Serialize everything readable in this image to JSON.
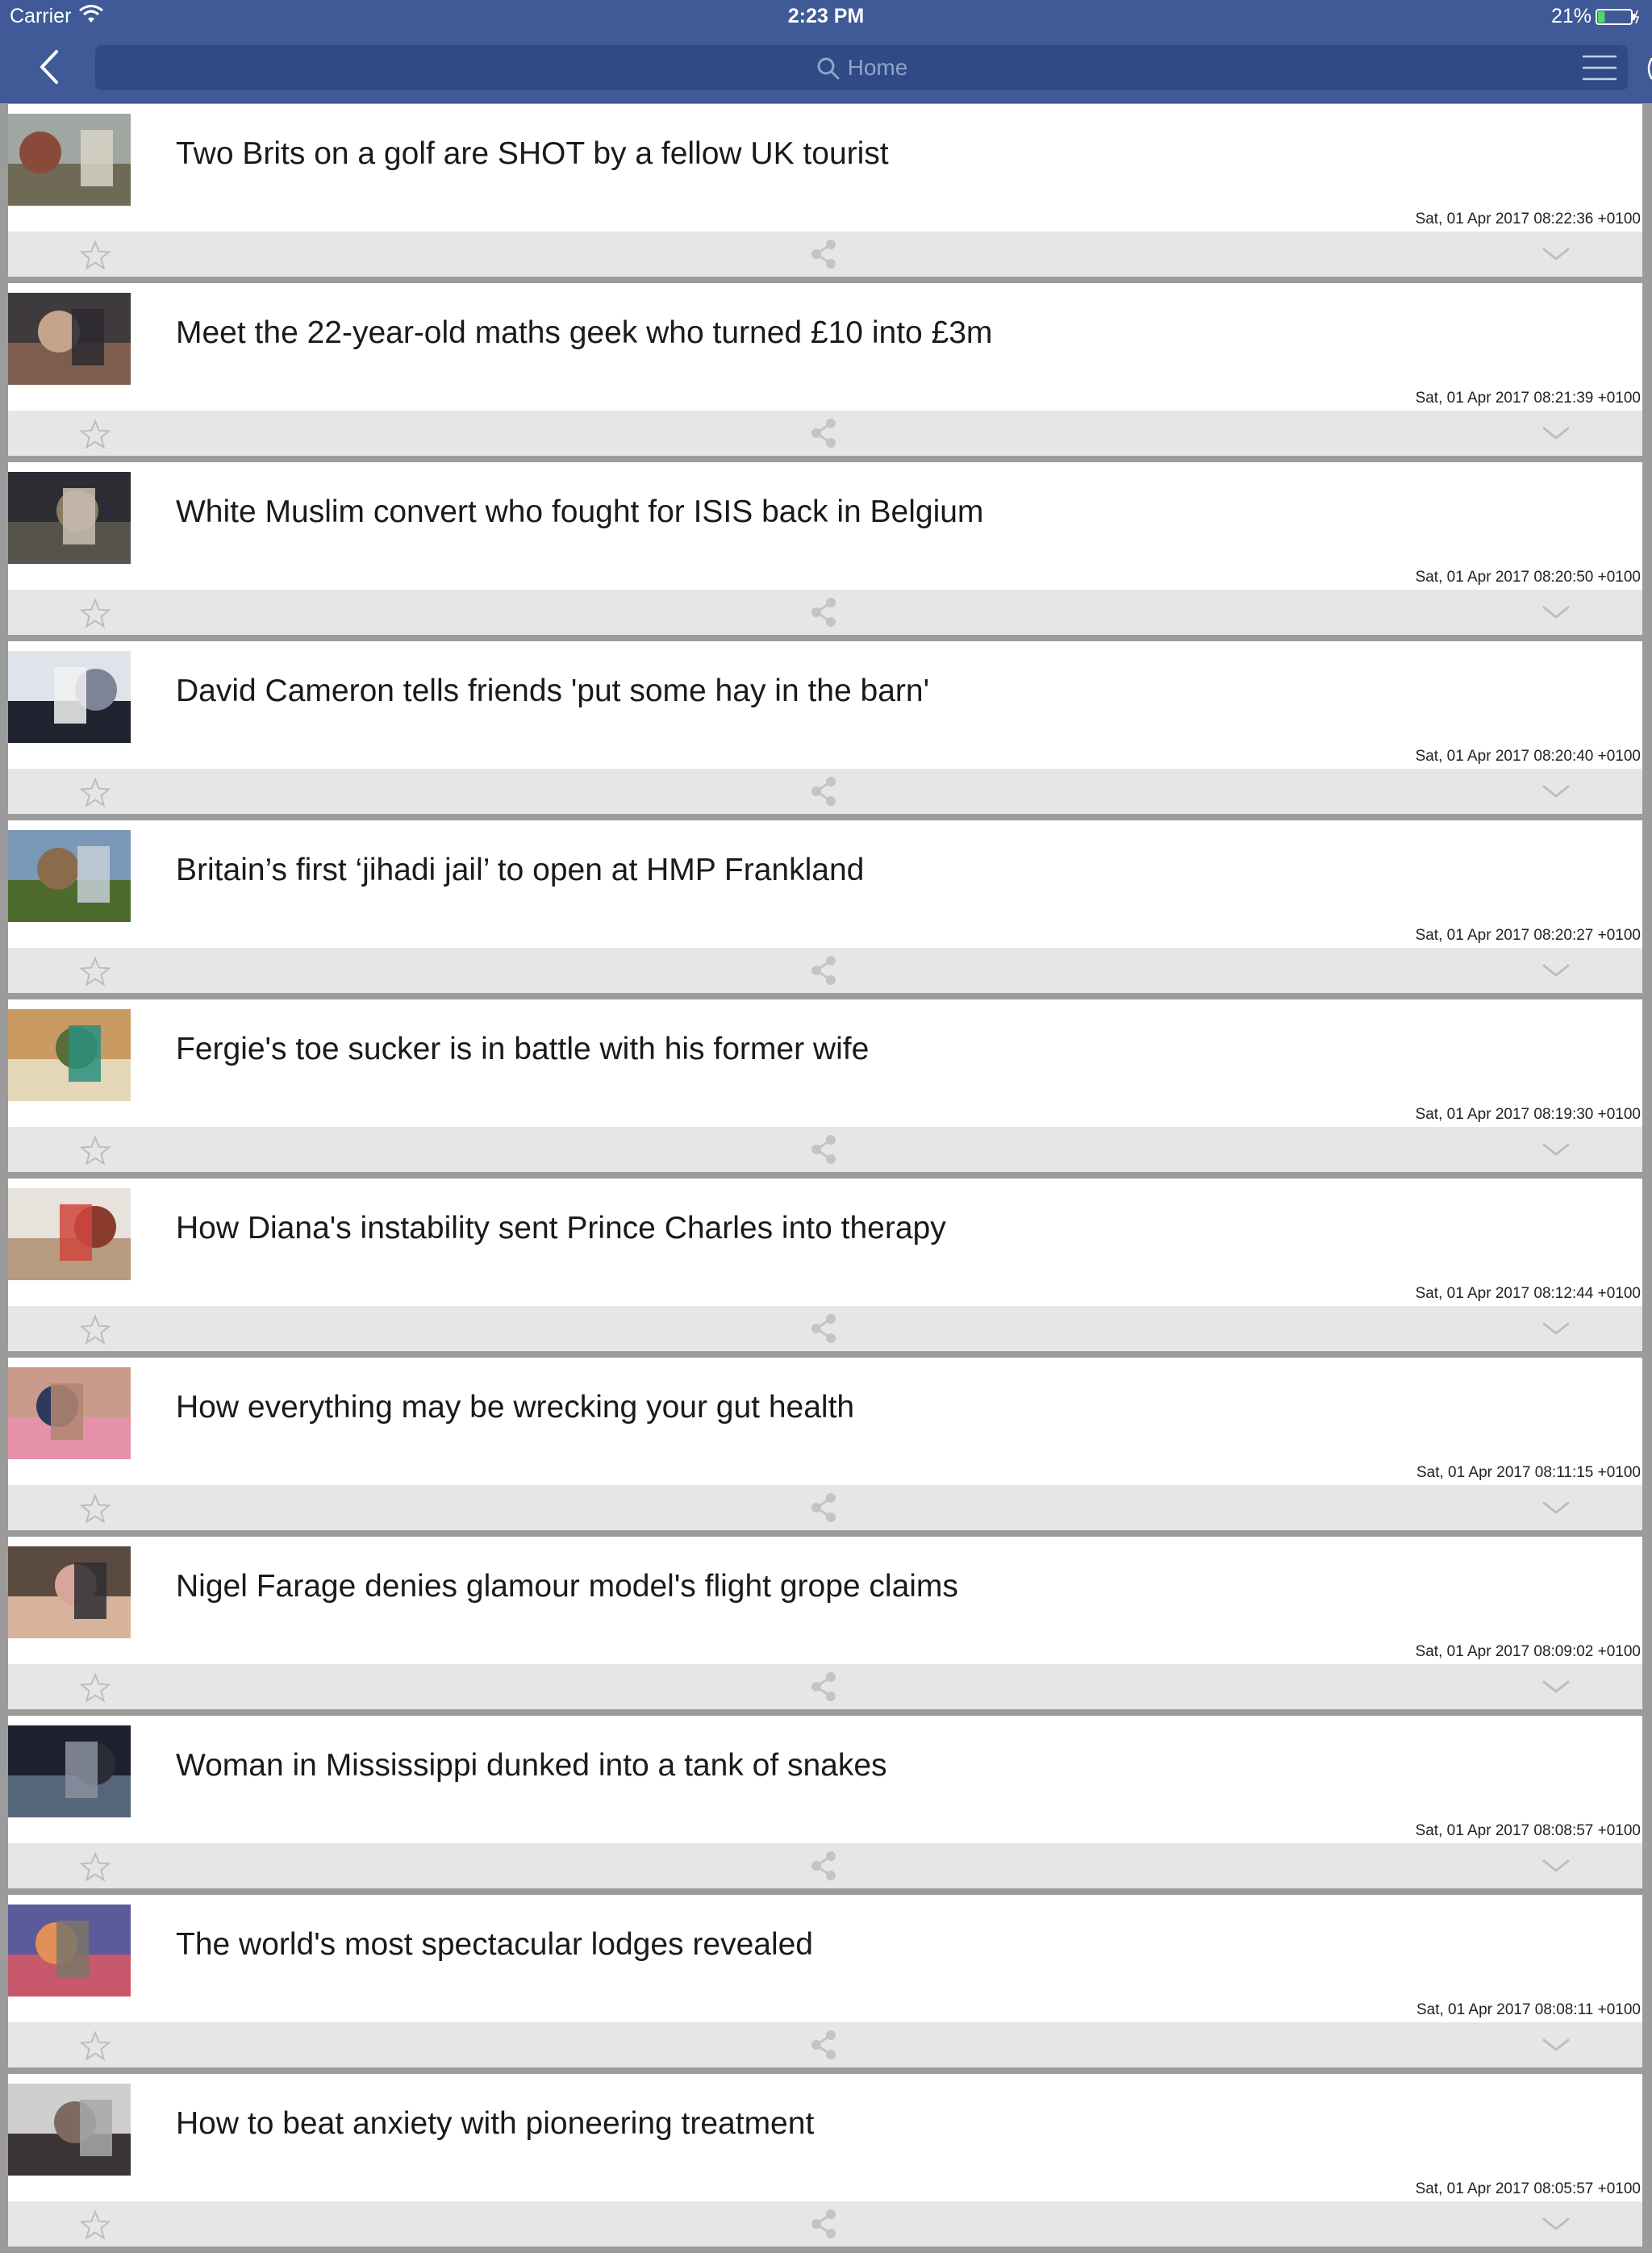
{
  "status_bar": {
    "carrier": "Carrier",
    "time": "2:23 PM",
    "battery": "21%",
    "battery_level": 0.21,
    "wifi_icon": "wifi-icon",
    "battery_icon": "battery-icon"
  },
  "nav": {
    "back_icon": "chevron-left-icon",
    "search_placeholder": "Home",
    "search_icon": "search-icon",
    "menu_icon": "hamburger-menu-icon"
  },
  "colors": {
    "nav_bar": "#3f5a97",
    "search_field": "#2f4a85",
    "card": "#ffffff",
    "action_bar": "#e6e6e6",
    "divider": "#9b9b9b"
  },
  "articles": [
    {
      "title": "Two Brits on a golf are SHOT by a fellow UK tourist",
      "timestamp": "Sat, 01 Apr 2017 08:22:36 +0100"
    },
    {
      "title": "Meet the 22-year-old maths geek who turned £10 into £3m",
      "timestamp": "Sat, 01 Apr 2017 08:21:39 +0100"
    },
    {
      "title": "White Muslim convert who fought for ISIS back in Belgium",
      "timestamp": "Sat, 01 Apr 2017 08:20:50 +0100"
    },
    {
      "title": "David Cameron tells friends 'put some hay in the barn'",
      "timestamp": "Sat, 01 Apr 2017 08:20:40 +0100"
    },
    {
      "title": "Britain’s first ‘jihadi jail’ to open at HMP Frankland",
      "timestamp": "Sat, 01 Apr 2017 08:20:27 +0100"
    },
    {
      "title": "Fergie's toe sucker is in battle with his former wife",
      "timestamp": "Sat, 01 Apr 2017 08:19:30 +0100"
    },
    {
      "title": "How Diana's instability sent Prince Charles into therapy",
      "timestamp": "Sat, 01 Apr 2017 08:12:44 +0100"
    },
    {
      "title": "How everything may be wrecking your gut health",
      "timestamp": "Sat, 01 Apr 2017 08:11:15 +0100"
    },
    {
      "title": "Nigel Farage denies glamour model's flight grope claims",
      "timestamp": "Sat, 01 Apr 2017 08:09:02 +0100"
    },
    {
      "title": "Woman in Mississippi dunked into a tank of snakes",
      "timestamp": "Sat, 01 Apr 2017 08:08:57 +0100"
    },
    {
      "title": "The world's most spectacular lodges revealed",
      "timestamp": "Sat, 01 Apr 2017 08:08:11 +0100"
    },
    {
      "title": "How to beat anxiety with pioneering treatment",
      "timestamp": "Sat, 01 Apr 2017 08:05:57 +0100"
    }
  ],
  "actions": {
    "favorite_icon": "star-outline-icon",
    "share_icon": "share-icon",
    "expand_icon": "chevron-down-icon"
  }
}
